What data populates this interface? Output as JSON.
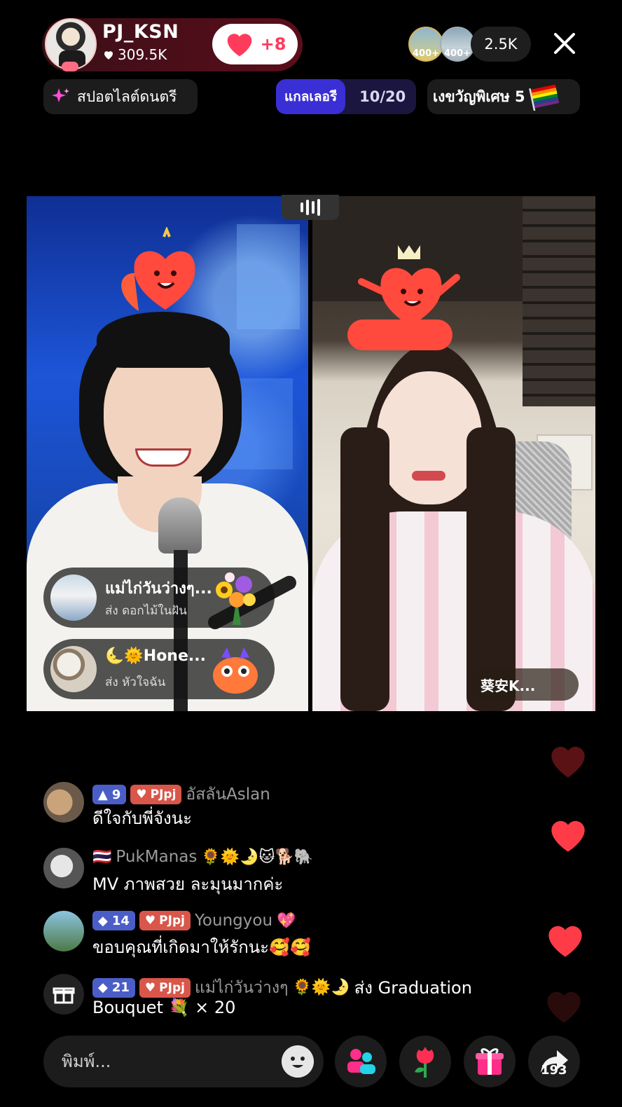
{
  "header": {
    "host_name": "PJ_KSN",
    "host_likes": "309.5K",
    "follow_label": "+8",
    "viewer_badges": [
      "400+",
      "400+"
    ],
    "viewer_count": "2.5K",
    "spotlight_label": "สปอตไลต์ดนตรี",
    "gallery_label": "แกลเลอรี",
    "gallery_count": "10/20",
    "special_gift_label": "เงขวัญพิเศษ 5"
  },
  "gifts": [
    {
      "sender": "แม่ไก่วันว่างๆ...",
      "action": "ส่ง ดอกไม้ในฝัน"
    },
    {
      "sender": "🌜🌞Hone...",
      "action": "ส่ง หัวใจฉัน"
    }
  ],
  "guest": {
    "name": "葵安K..."
  },
  "chat": [
    {
      "level": "9",
      "fan_badge": "PJpj",
      "username": "อัสลันAslan",
      "text": "ดีใจกับพี่จังนะ"
    },
    {
      "flag": "🇹🇭",
      "username": "PukManas",
      "name_emojis": "🌻🌞🌛🐱🐕🐘",
      "text": "MV ภาพสวย ละมุนมากค่ะ"
    },
    {
      "level": "14",
      "fan_badge": "PJpj",
      "username": "Youngyou",
      "name_emojis": "💖",
      "text": "ขอบคุณที่เกิดมาให้รักนะ🥰🥰"
    },
    {
      "level": "21",
      "fan_badge": "PJpj",
      "username": "แม่ไก่วันว่างๆ",
      "name_emojis": "🌻🌞🌛",
      "action": "ส่ง Graduation",
      "text": "Bouquet 💐 × 20"
    }
  ],
  "bottom": {
    "placeholder": "พิมพ์...",
    "share_count": "193"
  },
  "colors": {
    "accent": "#ff3b5c",
    "panel_bg": "#1c1c1c"
  }
}
